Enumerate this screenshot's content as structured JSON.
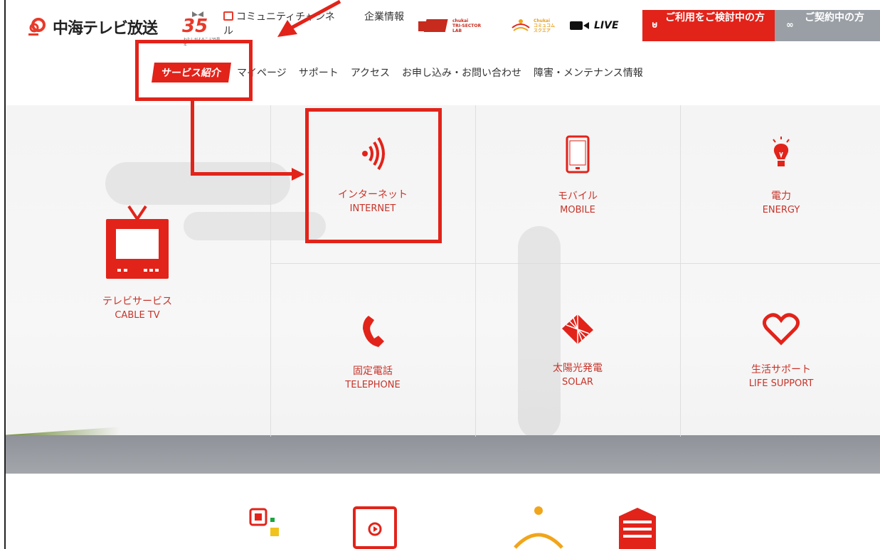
{
  "header": {
    "logo_text": "中海テレビ放送",
    "badge_number": "35",
    "badge_sub": "わたしがよろこぶ35周年",
    "community_label": "コミュニティチャンネル",
    "corp_label": "企業情報",
    "tri_sector_line1": "chukai",
    "tri_sector_line2": "TRI-SECTOR",
    "tri_sector_line3": "LAB",
    "community_square_line1": "Chukai",
    "community_square_line2": "コミュコム",
    "community_square_line3": "スクエア",
    "live_label": "LIVE",
    "cta_prospect": "ご利用をご検討中の方",
    "cta_member": "ご契約中の方"
  },
  "nav": {
    "items": [
      {
        "label": "サービス紹介",
        "active": true
      },
      {
        "label": "マイページ"
      },
      {
        "label": "サポート"
      },
      {
        "label": "アクセス"
      },
      {
        "label": "お申し込み・お問い合わせ"
      },
      {
        "label": "障害・メンテナンス情報"
      }
    ]
  },
  "services": {
    "tv": {
      "jp": "テレビサービス",
      "en": "CABLE TV",
      "icon": "tv-icon"
    },
    "internet": {
      "jp": "インターネット",
      "en": "INTERNET",
      "icon": "wireless-signal-icon"
    },
    "mobile": {
      "jp": "モバイル",
      "en": "MOBILE",
      "icon": "smartphone-icon"
    },
    "energy": {
      "jp": "電力",
      "en": "ENERGY",
      "icon": "light-bulb-icon"
    },
    "telephone": {
      "jp": "固定電話",
      "en": "TELEPHONE",
      "icon": "phone-handset-icon"
    },
    "solar": {
      "jp": "太陽光発電",
      "en": "SOLAR",
      "icon": "solar-panel-icon"
    },
    "life": {
      "jp": "生活サポート",
      "en": "LIFE SUPPORT",
      "icon": "heart-icon"
    }
  },
  "colors": {
    "brand_red": "#e2231a",
    "member_gray": "#9a9fa6",
    "annotation_red": "#e2231a"
  }
}
